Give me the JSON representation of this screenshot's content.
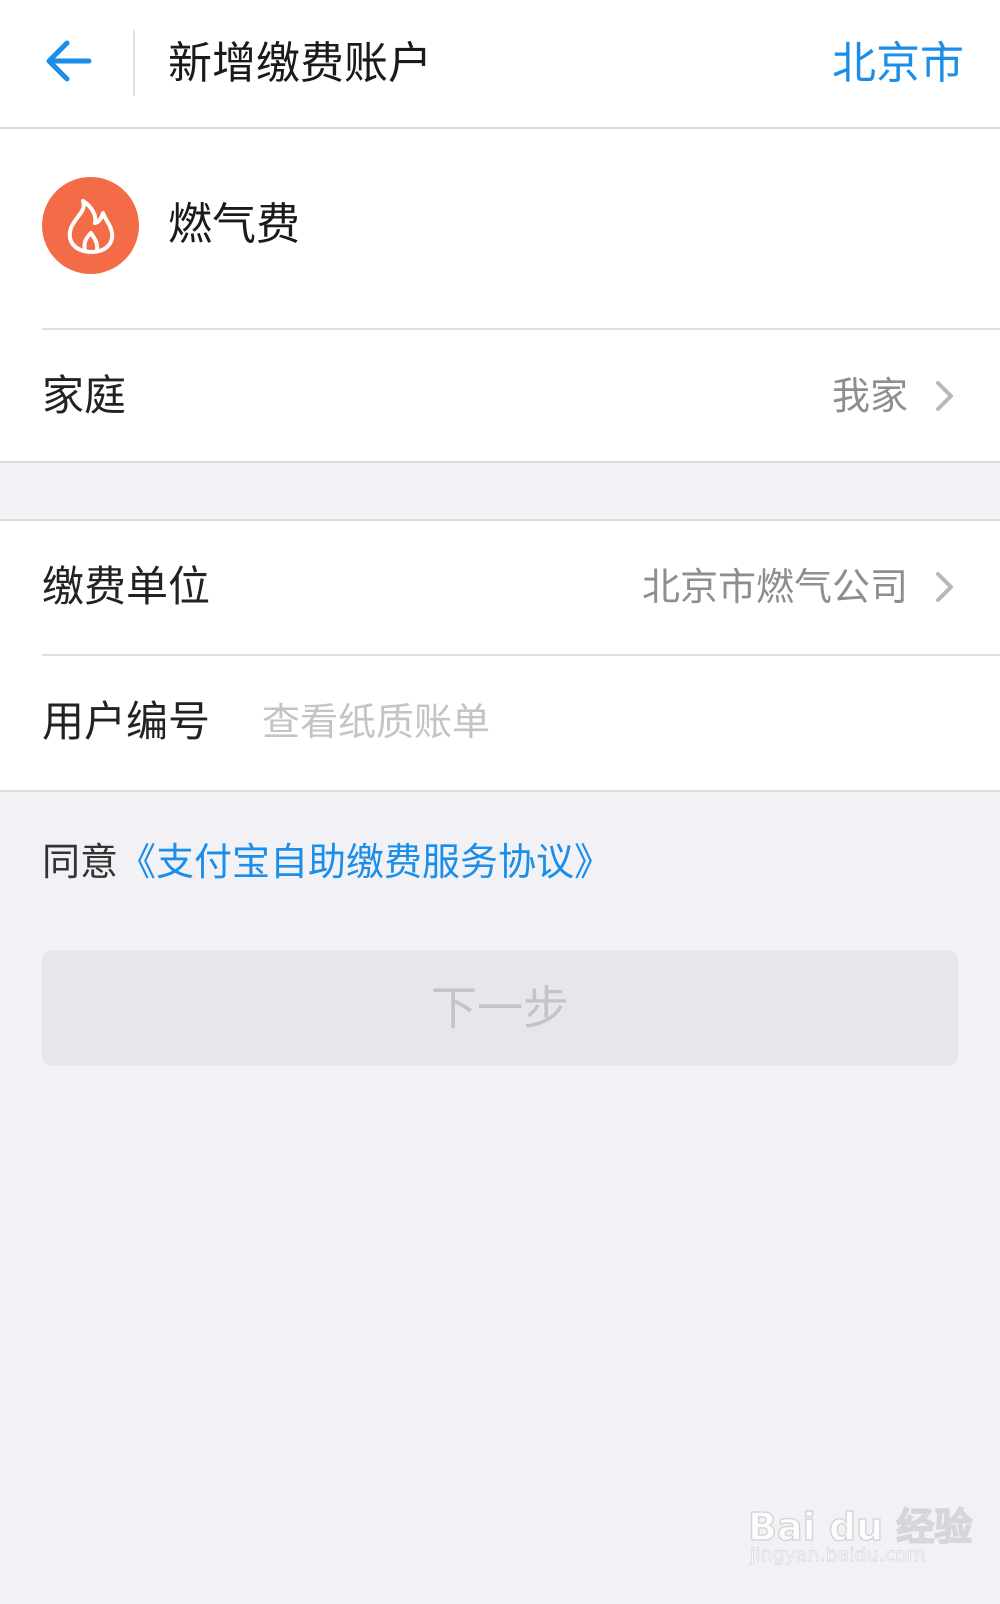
{
  "header": {
    "title": "新增缴费账户",
    "city": "北京市",
    "back_icon": "arrow-left-icon"
  },
  "service": {
    "name": "燃气费",
    "icon": "flame-icon",
    "icon_color": "#f46b47"
  },
  "family_row": {
    "label": "家庭",
    "value": "我家"
  },
  "company_row": {
    "label": "缴费单位",
    "value": "北京市燃气公司"
  },
  "account_row": {
    "label": "用户编号",
    "placeholder": "查看纸质账单",
    "value": ""
  },
  "agreement": {
    "prefix": "同意",
    "link": "《支付宝自助缴费服务协议》"
  },
  "next_button": {
    "label": "下一步",
    "enabled": false
  },
  "watermark": {
    "brand": "Bai du 经验",
    "url": "jingyan.baidu.com"
  },
  "colors": {
    "accent": "#1a8ee8",
    "page_bg": "#f2f2f6",
    "service_icon": "#f46b47",
    "disabled_button": "#e6e6eb"
  }
}
